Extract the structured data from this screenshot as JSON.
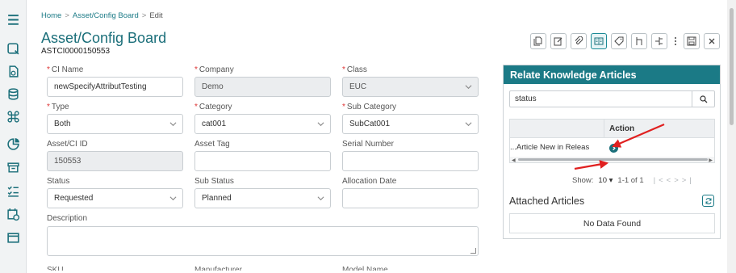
{
  "breadcrumb": {
    "home": "Home",
    "section": "Asset/Config Board",
    "current": "Edit",
    "sep": ">"
  },
  "page": {
    "title": "Asset/Config Board",
    "asset_id": "ASTCI0000150553"
  },
  "form": {
    "ci_name": {
      "label": "CI Name",
      "value": "newSpecifyAttributTesting",
      "required": true
    },
    "company": {
      "label": "Company",
      "value": "Demo",
      "required": true
    },
    "class": {
      "label": "Class",
      "value": "EUC",
      "required": true
    },
    "type": {
      "label": "Type",
      "value": "Both",
      "required": true
    },
    "category": {
      "label": "Category",
      "value": "cat001",
      "required": true
    },
    "sub_category": {
      "label": "Sub Category",
      "value": "SubCat001",
      "required": true
    },
    "asset_ci_id": {
      "label": "Asset/CI ID",
      "value": "150553"
    },
    "asset_tag": {
      "label": "Asset Tag",
      "value": ""
    },
    "serial_number": {
      "label": "Serial Number",
      "value": ""
    },
    "status": {
      "label": "Status",
      "value": "Requested"
    },
    "sub_status": {
      "label": "Sub Status",
      "value": "Planned"
    },
    "allocation_date": {
      "label": "Allocation Date",
      "value": ""
    },
    "description": {
      "label": "Description",
      "value": ""
    },
    "cut_labels": [
      "SKU",
      "Manufacturer",
      "Model Name"
    ],
    "required_mark": "*"
  },
  "knowledge": {
    "title": "Relate Knowledge Articles",
    "search_value": "status",
    "column_action": "Action",
    "rows": [
      {
        "title": "Article New in Releas..."
      }
    ],
    "pager": {
      "show_label": "Show:",
      "page_size": "10",
      "range": "1-1 of 1"
    },
    "attached_title": "Attached Articles",
    "no_data": "No Data Found"
  },
  "colors": {
    "accent": "#1b7a86",
    "annotation": "#e02020"
  }
}
